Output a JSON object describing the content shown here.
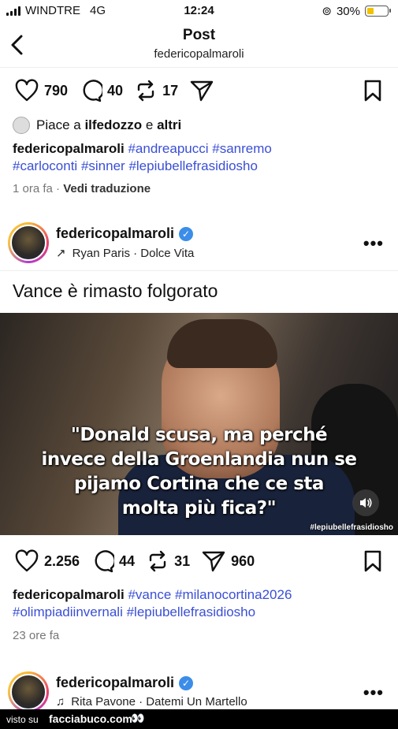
{
  "status": {
    "carrier": "WINDTRE",
    "network": "4G",
    "time": "12:24",
    "battery": "30%"
  },
  "header": {
    "title": "Post",
    "subtitle": "federicopalmaroli"
  },
  "post1": {
    "likes": "790",
    "comments": "40",
    "reposts": "17",
    "liked_by_prefix": "Piace a ",
    "liked_by_user": "ilfedozzo",
    "liked_by_and": " e ",
    "liked_by_rest": "altri",
    "caption_user": "federicopalmaroli",
    "tags_line1": [
      "#andreapucci",
      "#sanremo"
    ],
    "tags_line2": [
      "#carloconti",
      "#sinner",
      "#lepiubellefrasidiosho"
    ],
    "time": "1 ora fa",
    "translate": "Vedi traduzione"
  },
  "post2": {
    "user": "federicopalmaroli",
    "music": "Ryan Paris · Dolce Vita",
    "text": "Vance è rimasto folgorato",
    "quote_lines": [
      "\"Donald scusa, ma perché",
      "invece della Groenlandia nun se",
      "pijamo Cortina che ce sta",
      "molta più fica?\""
    ],
    "watermark": "#lepiubellefrasidiosho",
    "likes": "2.256",
    "comments": "44",
    "reposts": "31",
    "shares": "960",
    "caption_user": "federicopalmaroli",
    "tags_line1": [
      "#vance",
      "#milanocortina2026"
    ],
    "tags_line2": [
      "#olimpiadiinvernali",
      "#lepiubellefrasidiosho"
    ],
    "time": "23 ore fa"
  },
  "post3": {
    "user": "federicopalmaroli",
    "music": "Rita Pavone · Datemi Un Martello"
  },
  "footer": {
    "visto": "visto su",
    "brand": "facciabuco.com",
    "eyes": "👀"
  },
  "colors": {
    "hashtag": "#3a4fd6",
    "verified": "#3b8de8"
  }
}
